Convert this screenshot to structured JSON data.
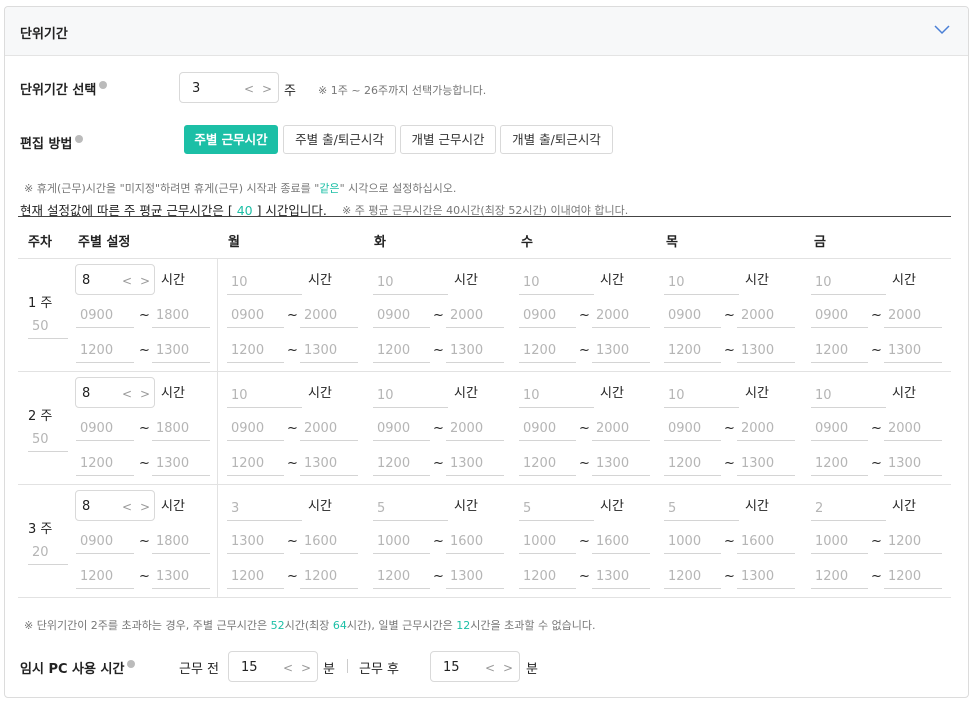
{
  "panel": {
    "title": "단위기간"
  },
  "unit_select": {
    "label": "단위기간 선택",
    "value": "3",
    "unit": "주",
    "hint": "※ 1주 ~ 26주까지 선택가능합니다."
  },
  "edit_method": {
    "label": "편집 방법",
    "options": [
      "주별 근무시간",
      "주별 출/퇴근시각",
      "개별 근무시간",
      "개별 출/퇴근시각"
    ],
    "selected": "주별 근무시간"
  },
  "notes": {
    "rest_prefix": "※ 휴게(근무)시간을 \"미지정\"하려면 휴게(근무) 시작과 종료를 \"",
    "rest_highlight": "같은",
    "rest_suffix": "\" 시각으로 설정하십시오.",
    "avg_prefix": "현재 설정값에 따른 주 평균 근무시간은 [ ",
    "avg_value": "40",
    "avg_suffix": " ] 시간입니다.",
    "avg_hint": "※ 주 평균 근무시간은 40시간(최장 52시간) 이내여야 합니다."
  },
  "table": {
    "headers": [
      "주차",
      "주별 설정",
      "월",
      "화",
      "수",
      "목",
      "금"
    ],
    "hour_unit": "시간",
    "tilde": "~",
    "weeks": [
      {
        "label": "1 주",
        "total": "50",
        "weekly_hours": "8",
        "weekly_work": [
          "0900",
          "1800"
        ],
        "weekly_rest": [
          "1200",
          "1300"
        ],
        "days": [
          {
            "hours": "10",
            "work": [
              "0900",
              "2000"
            ],
            "rest": [
              "1200",
              "1300"
            ]
          },
          {
            "hours": "10",
            "work": [
              "0900",
              "2000"
            ],
            "rest": [
              "1200",
              "1300"
            ]
          },
          {
            "hours": "10",
            "work": [
              "0900",
              "2000"
            ],
            "rest": [
              "1200",
              "1300"
            ]
          },
          {
            "hours": "10",
            "work": [
              "0900",
              "2000"
            ],
            "rest": [
              "1200",
              "1300"
            ]
          },
          {
            "hours": "10",
            "work": [
              "0900",
              "2000"
            ],
            "rest": [
              "1200",
              "1300"
            ]
          }
        ]
      },
      {
        "label": "2 주",
        "total": "50",
        "weekly_hours": "8",
        "weekly_work": [
          "0900",
          "1800"
        ],
        "weekly_rest": [
          "1200",
          "1300"
        ],
        "days": [
          {
            "hours": "10",
            "work": [
              "0900",
              "2000"
            ],
            "rest": [
              "1200",
              "1300"
            ]
          },
          {
            "hours": "10",
            "work": [
              "0900",
              "2000"
            ],
            "rest": [
              "1200",
              "1300"
            ]
          },
          {
            "hours": "10",
            "work": [
              "0900",
              "2000"
            ],
            "rest": [
              "1200",
              "1300"
            ]
          },
          {
            "hours": "10",
            "work": [
              "0900",
              "2000"
            ],
            "rest": [
              "1200",
              "1300"
            ]
          },
          {
            "hours": "10",
            "work": [
              "0900",
              "2000"
            ],
            "rest": [
              "1200",
              "1300"
            ]
          }
        ]
      },
      {
        "label": "3 주",
        "total": "20",
        "weekly_hours": "8",
        "weekly_work": [
          "0900",
          "1800"
        ],
        "weekly_rest": [
          "1200",
          "1300"
        ],
        "days": [
          {
            "hours": "3",
            "work": [
              "1300",
              "1600"
            ],
            "rest": [
              "1200",
              "1200"
            ]
          },
          {
            "hours": "5",
            "work": [
              "1000",
              "1600"
            ],
            "rest": [
              "1200",
              "1300"
            ]
          },
          {
            "hours": "5",
            "work": [
              "1000",
              "1600"
            ],
            "rest": [
              "1200",
              "1300"
            ]
          },
          {
            "hours": "5",
            "work": [
              "1000",
              "1600"
            ],
            "rest": [
              "1200",
              "1300"
            ]
          },
          {
            "hours": "2",
            "work": [
              "1000",
              "1200"
            ],
            "rest": [
              "1200",
              "1200"
            ]
          }
        ]
      }
    ]
  },
  "footer_note": {
    "p1": "※ 단위기간이 2주를 초과하는 경우, 주별 근무시간은 ",
    "v1": "52",
    "p2": "시간(최장 ",
    "v2": "64",
    "p3": "시간), 일별 근무시간은 ",
    "v3": "12",
    "p4": "시간을 초과할 수 없습니다."
  },
  "pc_time": {
    "label": "임시 PC 사용 시간",
    "before_label": "근무 전",
    "before_value": "15",
    "after_label": "근무 후",
    "after_value": "15",
    "unit": "분"
  },
  "colors": {
    "accent": "#1cbfa6"
  },
  "icons": {
    "collapse": "chevron-down-icon",
    "info": "info-icon",
    "prev": "chevron-left-icon",
    "next": "chevron-right-icon"
  }
}
